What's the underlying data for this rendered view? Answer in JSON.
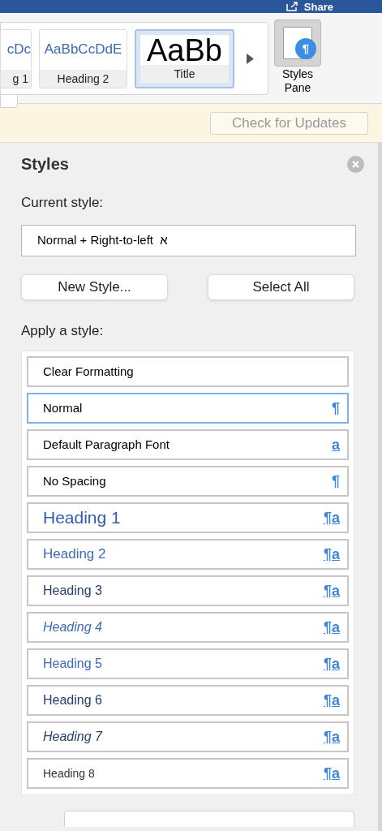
{
  "title_bar": {
    "share": "Share"
  },
  "gallery": [
    {
      "preview": "cDc",
      "label": "g 1",
      "kind": "heading",
      "selected": false
    },
    {
      "preview": "AaBbCcDdE",
      "label": "Heading 2",
      "kind": "heading",
      "selected": false
    },
    {
      "preview": "AaBb",
      "label": "Title",
      "kind": "title",
      "selected": true
    }
  ],
  "styles_pane_button": {
    "label": "Styles Pane",
    "icon_glyph": "¶"
  },
  "update_bar": {
    "button": "Check for Updates"
  },
  "pane": {
    "title": "Styles",
    "current_style_label": "Current style:",
    "current_style": "Normal + Right-to-left  א",
    "buttons": [
      "New Style...",
      "Select All"
    ],
    "apply_label": "Apply a style:",
    "styles": [
      {
        "name": "Clear Formatting",
        "kind": "plain",
        "selected": false
      },
      {
        "name": "Normal",
        "kind": "paragraph",
        "marker": "¶",
        "selected": true
      },
      {
        "name": "Default Paragraph Font",
        "kind": "character",
        "marker": "a",
        "selected": false
      },
      {
        "name": "No Spacing",
        "kind": "paragraph",
        "marker": "¶",
        "selected": false
      },
      {
        "name": "Heading 1",
        "kind": "heading1",
        "marker": "¶a",
        "selected": false
      },
      {
        "name": "Heading 2",
        "kind": "heading2",
        "marker": "¶a",
        "selected": false
      },
      {
        "name": "Heading 3",
        "kind": "heading3",
        "marker": "¶a",
        "selected": false
      },
      {
        "name": "Heading 4",
        "kind": "heading4",
        "marker": "¶a",
        "selected": false
      },
      {
        "name": "Heading 5",
        "kind": "heading5",
        "marker": "¶a",
        "selected": false
      },
      {
        "name": "Heading 6",
        "kind": "heading6",
        "marker": "¶a",
        "selected": false
      },
      {
        "name": "Heading 7",
        "kind": "heading7",
        "marker": "¶a",
        "selected": false
      },
      {
        "name": "Heading 8",
        "kind": "heading8",
        "marker": "¶a",
        "selected": false
      }
    ]
  }
}
